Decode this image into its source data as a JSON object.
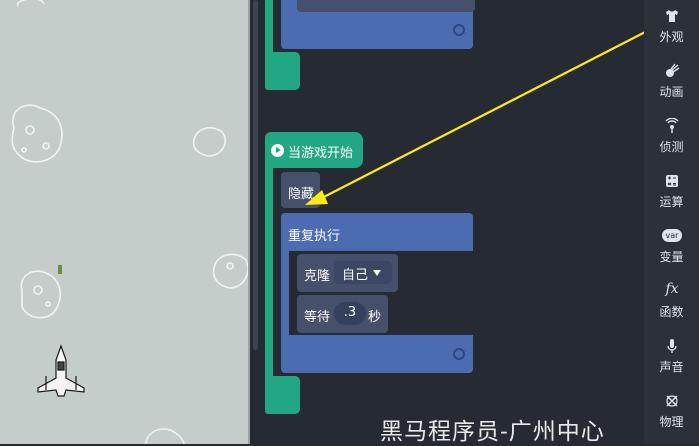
{
  "categories": [
    {
      "label": "外观",
      "icon": "shirt-icon"
    },
    {
      "label": "动画",
      "icon": "comet-icon"
    },
    {
      "label": "侦测",
      "icon": "radar-icon"
    },
    {
      "label": "运算",
      "icon": "calculator-icon"
    },
    {
      "label": "变量",
      "icon": "var-icon"
    },
    {
      "label": "函数",
      "icon": "fx-icon"
    },
    {
      "label": "声音",
      "icon": "microphone-icon"
    },
    {
      "label": "物理",
      "icon": "physics-icon"
    }
  ],
  "var_icon_text": "var",
  "fx_icon_text": "fx",
  "blocks": {
    "event_label": "当游戏开始",
    "hide_label": "隐藏",
    "repeat_label": "重复执行",
    "clone_label": "克隆",
    "clone_target": "自己",
    "wait_label": "等待",
    "wait_value": ".3",
    "wait_unit": "秒"
  },
  "watermark": "黑马程序员-广州中心",
  "colors": {
    "event": "#21a883",
    "control": "#4b6cb0",
    "looks": "#46506a",
    "arrow": "#ffee00"
  }
}
